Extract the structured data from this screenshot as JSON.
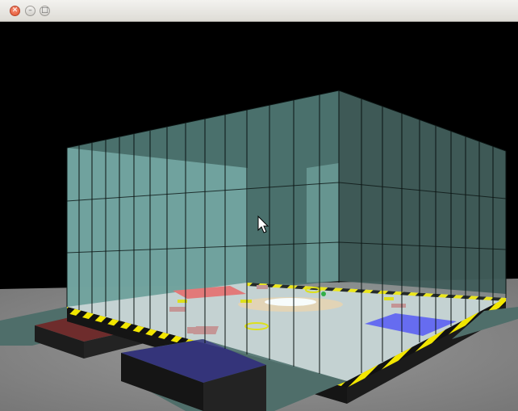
{
  "window": {
    "title": "",
    "controls": {
      "close": "close-icon",
      "minimize": "minimize-icon",
      "maximize": "maximize-icon"
    }
  },
  "scene": {
    "description_icon": "3d-arena-viewport",
    "colors": {
      "sky": "#000000",
      "ground": "#8c8c8c",
      "wall": "#5f8f8a",
      "floor": "#c5d0d0",
      "hazard_yellow": "#f2e600",
      "hazard_black": "#111111",
      "red_zone": "#e86a6a",
      "blue_zone": "#5a5cf2",
      "red_pad": "#6e2c2c",
      "blue_pad": "#34347a"
    },
    "cursor": "mouse-pointer-icon"
  }
}
